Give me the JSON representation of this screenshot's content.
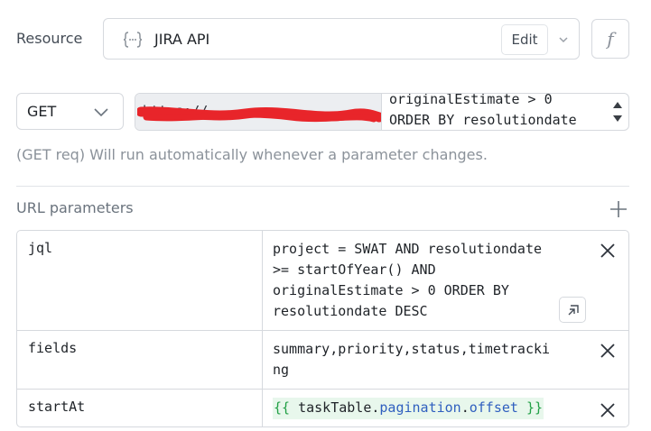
{
  "resource": {
    "label": "Resource",
    "name": "JIRA API",
    "edit_label": "Edit",
    "icon": "braces-icon",
    "fx_label": "f"
  },
  "request": {
    "method": "GET",
    "url_base": "https://",
    "url_query_lines": [
      "originalEstimate > 0",
      "ORDER BY resolutiondate"
    ],
    "hint": "(GET req) Will run automatically whenever a parameter changes."
  },
  "params": {
    "title": "URL parameters",
    "rows": [
      {
        "key": "jql",
        "value": "project = SWAT AND resolutiondate\n>= startOfYear() AND\noriginalEstimate > 0 ORDER BY\nresolutiondate DESC"
      },
      {
        "key": "fields",
        "value": "summary,priority,status,timetracki\nng"
      },
      {
        "key": "startAt",
        "template": {
          "open": "{{",
          "var": "taskTable",
          "prop1": "pagination",
          "prop2": "offset",
          "close": "}}"
        }
      }
    ]
  },
  "colors": {
    "border": "#d6d9de",
    "redaction": "#e8252a",
    "template_bg": "#e8f7ec",
    "template_brace": "#22a046",
    "template_prop": "#2f5fbf"
  }
}
